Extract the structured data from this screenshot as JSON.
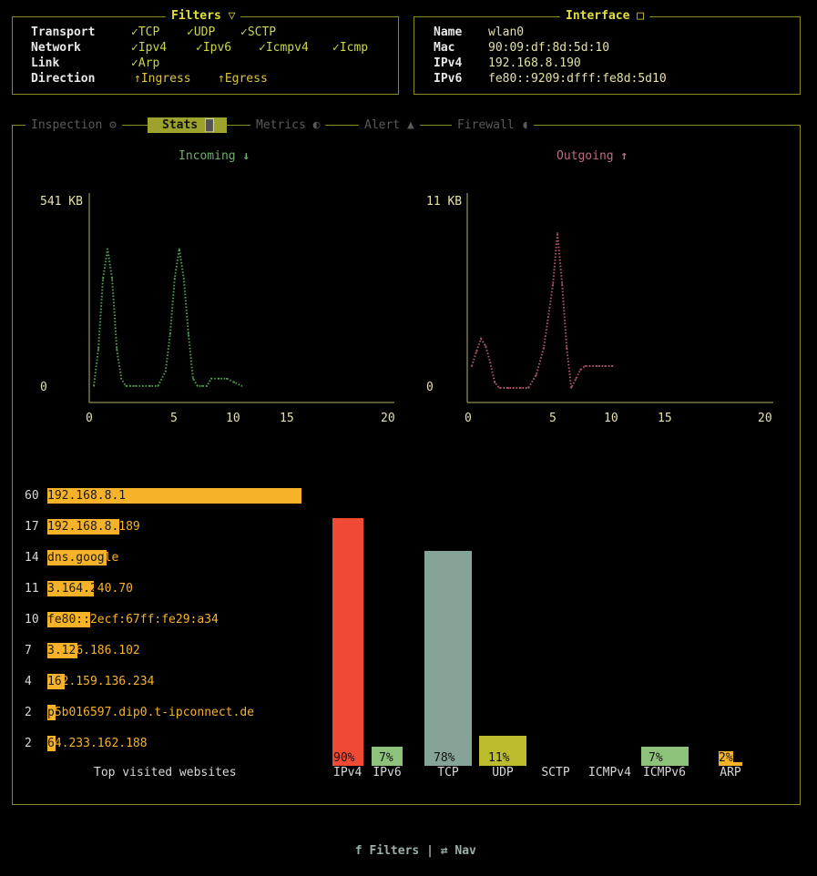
{
  "filters": {
    "title": "Filters",
    "transport_label": "Transport",
    "network_label": "Network",
    "link_label": "Link",
    "direction_label": "Direction",
    "transport": [
      "TCP",
      "UDP",
      "SCTP"
    ],
    "network": [
      "Ipv4",
      "Ipv6",
      "Icmpv4",
      "Icmp"
    ],
    "link": [
      "Arp"
    ],
    "direction": [
      "Ingress",
      "Egress"
    ],
    "check_glyph": "✓",
    "dir_glyph": "↑"
  },
  "interface": {
    "title": "Interface",
    "name_label": "Name",
    "name": "wlan0",
    "mac_label": "Mac",
    "mac": "90:09:df:8d:5d:10",
    "ipv4_label": "IPv4",
    "ipv4": "192.168.8.190",
    "ipv6_label": "IPv6",
    "ipv6": "fe80::9209:dfff:fe8d:5d10"
  },
  "tabs": [
    {
      "label": "Inspection",
      "icon": "inspection-icon"
    },
    {
      "label": "Stats",
      "icon": "stats-icon",
      "active": true
    },
    {
      "label": "Metrics",
      "icon": "metrics-icon"
    },
    {
      "label": "Alert",
      "icon": "alert-icon"
    },
    {
      "label": "Firewall",
      "icon": "shield-icon"
    }
  ],
  "incoming": {
    "title": "Incoming",
    "ymax_label": "541 KB",
    "ymin_label": "0",
    "xticks": [
      "0",
      "5",
      "10",
      "15",
      "20"
    ],
    "color": "#4fa04f"
  },
  "outgoing": {
    "title": "Outgoing",
    "ymax_label": "11 KB",
    "ymin_label": "0",
    "xticks": [
      "0",
      "5",
      "10",
      "15",
      "20"
    ],
    "color": "#b0566a"
  },
  "chart_data": [
    {
      "type": "line",
      "title": "Incoming",
      "x": [
        0.3,
        0.6,
        0.9,
        1.2,
        1.5,
        1.8,
        2.1,
        2.4,
        2.7,
        3,
        3.5,
        4,
        4.5,
        5,
        5.3,
        5.6,
        5.9,
        6.2,
        6.5,
        6.8,
        7.1,
        7.4,
        7.7,
        8,
        8.5,
        9,
        9.5,
        10
      ],
      "y": [
        20,
        120,
        310,
        390,
        310,
        120,
        40,
        20,
        20,
        20,
        20,
        20,
        20,
        60,
        160,
        310,
        390,
        310,
        160,
        40,
        20,
        20,
        20,
        40,
        40,
        40,
        30,
        20
      ],
      "unit": "KB",
      "ylim": [
        0,
        541
      ],
      "xlim": [
        0,
        20
      ]
    },
    {
      "type": "line",
      "title": "Outgoing",
      "x": [
        0.3,
        0.6,
        0.9,
        1.2,
        1.5,
        1.8,
        2.1,
        2.4,
        2.7,
        3,
        3.5,
        4,
        4.5,
        5,
        5.3,
        5.6,
        5.9,
        6.2,
        6.5,
        6.8,
        7.1,
        7.4,
        7.7,
        8,
        8.5,
        9,
        9.5
      ],
      "y": [
        1.5,
        2.3,
        3.0,
        2.6,
        1.7,
        0.6,
        0.3,
        0.3,
        0.3,
        0.3,
        0.3,
        0.3,
        1.0,
        2.5,
        4.2,
        6.0,
        8.8,
        6.0,
        2.5,
        0.3,
        0.8,
        1.3,
        1.5,
        1.5,
        1.5,
        1.5,
        1.5
      ],
      "unit": "KB",
      "ylim": [
        0,
        11
      ],
      "xlim": [
        0,
        20
      ]
    },
    {
      "type": "bar",
      "title": "Top visited websites",
      "categories": [
        "192.168.8.1",
        "192.168.8.189",
        "dns.google",
        "3.164.240.70",
        "fe80::2ecf:67ff:fe29:a34",
        "3.126.186.102",
        "162.159.136.234",
        "p5b016597.dip0.t-ipconnect.de",
        "64.233.162.188"
      ],
      "values": [
        60,
        17,
        14,
        11,
        10,
        7,
        4,
        2,
        2
      ]
    },
    {
      "type": "bar",
      "categories": [
        "IPv4",
        "IPv6",
        "TCP",
        "UDP",
        "SCTP",
        "ICMPv4",
        "ICMPv6",
        "ARP"
      ],
      "values": [
        90,
        7,
        78,
        11,
        0,
        0,
        7,
        2
      ],
      "labels": [
        "90%",
        "7%",
        "78%",
        "11%",
        "",
        "",
        "7%",
        "2%"
      ],
      "colors": [
        "#f04a37",
        "#8cc279",
        "#86a397",
        "#bdbc2c",
        "#888888",
        "#888888",
        "#8cc279",
        "#f6b32a"
      ],
      "ylim": [
        0,
        100
      ]
    }
  ],
  "top_sites": {
    "title": "Top visited websites",
    "color": "#f6b32a",
    "rows": [
      {
        "count": "60",
        "host": "192.168.8.1",
        "value": 60
      },
      {
        "count": "17",
        "host": "192.168.8.189",
        "value": 17
      },
      {
        "count": "14",
        "host": "dns.google",
        "value": 14
      },
      {
        "count": "11",
        "host": "3.164.240.70",
        "value": 11
      },
      {
        "count": "10",
        "host": "fe80::2ecf:67ff:fe29:a34",
        "value": 10
      },
      {
        "count": "7",
        "host": "3.126.186.102",
        "value": 7
      },
      {
        "count": "4",
        "host": "162.159.136.234",
        "value": 4
      },
      {
        "count": "2",
        "host": "p5b016597.dip0.t-ipconnect.de",
        "value": 2
      },
      {
        "count": "2",
        "host": "64.233.162.188",
        "value": 2
      }
    ]
  },
  "protocols": {
    "bars": [
      {
        "name": "IPv4",
        "value": 90,
        "label": "90%",
        "color": "#f04a37"
      },
      {
        "name": "IPv6",
        "value": 7,
        "label": "7%",
        "color": "#8cc279"
      },
      {
        "name": "TCP",
        "value": 78,
        "label": "78%",
        "color": "#86a397"
      },
      {
        "name": "UDP",
        "value": 11,
        "label": "11%",
        "color": "#bdbc2c"
      },
      {
        "name": "SCTP",
        "value": 0,
        "label": "",
        "color": "#888888"
      },
      {
        "name": "ICMPv4",
        "value": 0,
        "label": "",
        "color": "#888888"
      },
      {
        "name": "ICMPv6",
        "value": 7,
        "label": "7%",
        "color": "#8cc279"
      },
      {
        "name": "ARP",
        "value": 2,
        "label": "2%",
        "color": "#f6b32a"
      }
    ]
  },
  "footer": {
    "filters_key": "f",
    "filters_label": "Filters",
    "separator": "|",
    "nav_icon": "swap-icon",
    "nav_label": "Nav"
  }
}
